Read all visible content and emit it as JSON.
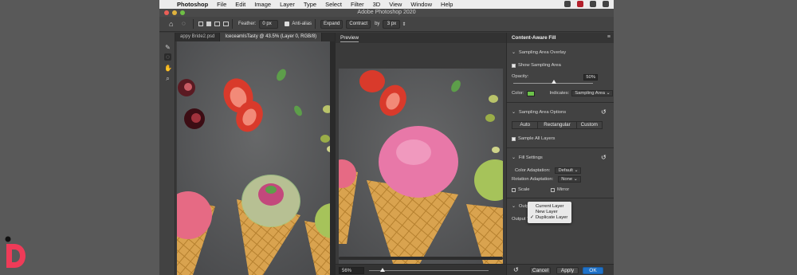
{
  "menubar": {
    "app": "Photoshop",
    "items": [
      "File",
      "Edit",
      "Image",
      "Layer",
      "Type",
      "Select",
      "Filter",
      "3D",
      "View",
      "Window",
      "Help"
    ]
  },
  "window": {
    "title": "Adobe Photoshop 2020"
  },
  "options": {
    "feather_label": "Feather:",
    "feather_value": "0 px",
    "antialias_label": "Anti-alias",
    "expand_label": "Expand",
    "contract_label": "Contract",
    "by_label": "by",
    "by_value": "3 px"
  },
  "tabs": [
    {
      "label": "appy Bride2.psd"
    },
    {
      "label": "IceceamIsTasty @ 43.5% (Layer 0, RGB/8)"
    }
  ],
  "preview": {
    "tab_label": "Preview",
    "zoom": "56%"
  },
  "panel": {
    "title": "Content-Aware Fill",
    "sampling_overlay": {
      "header": "Sampling Area Overlay",
      "show_label": "Show Sampling Area",
      "opacity_label": "Opacity:",
      "opacity_value": "50%",
      "color_label": "Color:",
      "indicates_label": "Indicates:",
      "indicates_value": "Sampling Area",
      "overlay_color": "#6cc24a"
    },
    "sampling_options": {
      "header": "Sampling Area Options",
      "modes": [
        "Auto",
        "Rectangular",
        "Custom"
      ],
      "sample_all_label": "Sample All Layers"
    },
    "fill_settings": {
      "header": "Fill Settings",
      "color_adapt_label": "Color Adaptation:",
      "color_adapt_value": "Default",
      "rotation_label": "Rotation Adaptation:",
      "rotation_value": "None",
      "scale_label": "Scale",
      "mirror_label": "Mirror"
    },
    "output": {
      "header": "Outp",
      "output_to_label": "Output T",
      "menu": [
        {
          "label": "Current Layer",
          "checked": false
        },
        {
          "label": "New Layer",
          "checked": false
        },
        {
          "label": "Duplicate Layer",
          "checked": true
        }
      ]
    },
    "footer": {
      "cancel": "Cancel",
      "apply": "Apply",
      "ok": "OK"
    }
  },
  "colors": {
    "accent": "#1f72c9",
    "brand": "#ef3b58"
  }
}
